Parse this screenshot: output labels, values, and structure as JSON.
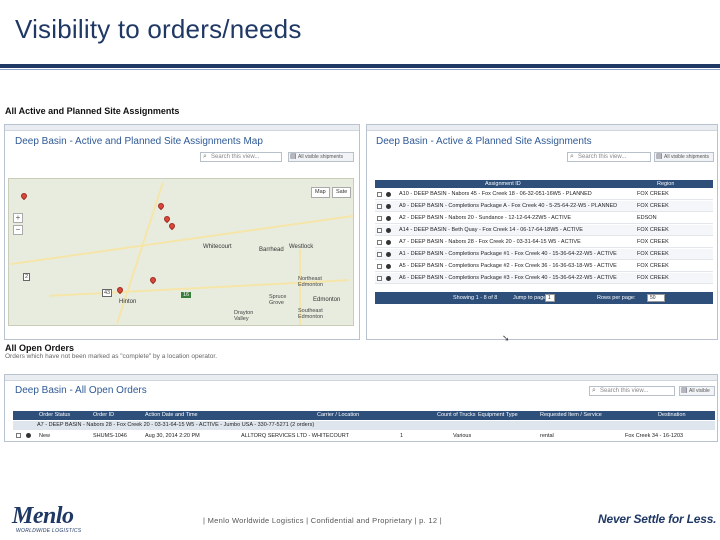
{
  "slide": {
    "title": "Visibility to orders/needs"
  },
  "assignments_section": {
    "heading": "All Active and Planned Site Assignments"
  },
  "map_panel": {
    "title": "Deep Basin - Active and Planned Site Assignments Map",
    "search_placeholder": "Search this view...",
    "view_button": "All visible shipments",
    "map_type_buttons": [
      "Map",
      "Sate"
    ],
    "zoom_in": "+",
    "zoom_out": "−",
    "places": [
      "Whitecourt",
      "Barrhead",
      "Westlock",
      "Northeast Edmonton",
      "Spruce Grove",
      "Edmonton",
      "Southeast Edmonton",
      "Hinton",
      "Drayton Valley"
    ],
    "highway_shields": [
      "43",
      "16",
      "2"
    ]
  },
  "table_panel": {
    "title": "Deep Basin - Active & Planned Site Assignments",
    "search_placeholder": "Search this view...",
    "view_button": "All visible shipments",
    "columns": [
      "Assignment ID",
      "Region"
    ],
    "rows": [
      {
        "id": "A10 - DEEP BASIN - Nabors 45 - Fox Creek 18 - 06-32-051-16W5 - PLANNED",
        "region": "FOX CREEK"
      },
      {
        "id": "A9 - DEEP BASIN - Completions Package A - Fox Creek 40 - 5-25-64-22-W5 - PLANNED",
        "region": "FOX CREEK"
      },
      {
        "id": "A2 - DEEP BASIN - Nabors 20 - Sundance - 12-12-64-22W5 - ACTIVE",
        "region": "EDSON"
      },
      {
        "id": "A14 - DEEP BASIN - Beth Quay - Fox Creek 14 - 06-17-64-18W5 - ACTIVE",
        "region": "FOX CREEK"
      },
      {
        "id": "A7 - DEEP BASIN - Nabors 28 - Fox Creek 20 - 03-31-64-15 W5 - ACTIVE",
        "region": "FOX CREEK"
      },
      {
        "id": "A1 - DEEP BASIN - Completions Package #1 - Fox Creek 40 - 15-36-64-22-W5 - ACTIVE",
        "region": "FOX CREEK"
      },
      {
        "id": "A5 - DEEP BASIN - Completions Package #2 - Fox Creek 36 - 16-36-63-18-W5 - ACTIVE",
        "region": "FOX CREEK"
      },
      {
        "id": "A6 - DEEP BASIN - Completions Package #3 - Fox Creek 40 - 15-36-64-22-W5 - ACTIVE",
        "region": "FOX CREEK"
      }
    ],
    "pager_text": "Showing 1 - 8 of 8",
    "jump_label": "Jump to page:",
    "jump_value": "1",
    "rows_per_page_label": "Rows per page:",
    "rows_per_page_value": "50"
  },
  "orders_section": {
    "heading": "All Open Orders",
    "subheading": "Orders which have not been marked as \"complete\" by a location operator."
  },
  "orders_panel": {
    "title": "Deep Basin - All Open Orders",
    "search_placeholder": "Search this view...",
    "view_button": "All visible shipments",
    "columns": [
      "Order Status",
      "Order ID",
      "Action Date and Time",
      "Carrier / Location",
      "Count of Trucks",
      "Equipment Type",
      "Requested Item / Service",
      "Destination"
    ],
    "group_row": "A7 - DEEP BASIN - Nabors 28 - Fox Creek 20 - 03-31-64-15 W5 - ACTIVE - Jumbo USA - 330-77-5271 (2 orders)",
    "rows": [
      {
        "status": "New",
        "order_id": "SHUMS-1046",
        "date": "Aug 30, 2014 2:20 PM",
        "carrier": "ALLTORQ SERVICES LTD - WHITECOURT",
        "trucks": "1",
        "equipment": "Various",
        "item": "rental",
        "destination": "Fox Creek 34 - 16-1203"
      }
    ]
  },
  "footer": {
    "logo": "Menlo",
    "logo_sub": "WORLDWIDE LOGISTICS",
    "text": "| Menlo Worldwide Logistics | Confidential and Proprietary | p. 12 |",
    "tagline": "Never Settle for Less."
  },
  "colors": {
    "title_blue": "#1f3864",
    "panel_title_blue": "#2f5a96",
    "table_header": "#2d4f7a",
    "map_pin_red": "#d9473b"
  }
}
